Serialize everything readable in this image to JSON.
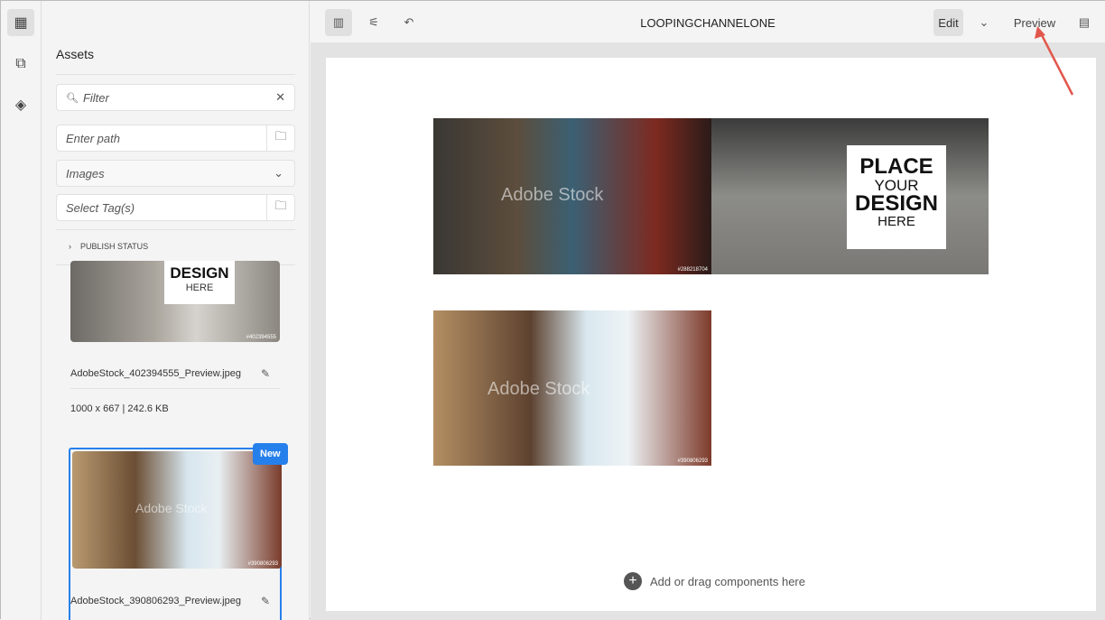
{
  "rail": {
    "items": [
      "assets-icon",
      "components-icon",
      "layers-icon"
    ]
  },
  "panel": {
    "title": "Assets",
    "filter_placeholder": "Filter",
    "path_placeholder": "Enter path",
    "type_select": "Images",
    "tags_placeholder": "Select Tag(s)",
    "publish_status": "PUBLISH STATUS",
    "assets": [
      {
        "name": "AdobeStock_402394555_Preview.jpeg",
        "meta": "1000 x 667 | 242.6 KB",
        "thumb_text": "DESIGN",
        "thumb_text2": "HERE",
        "stock_id": "#402394555"
      },
      {
        "name": "AdobeStock_390806293_Preview.jpeg",
        "badge": "New",
        "watermark": "Adobe Stock",
        "stock_id": "#390806293"
      }
    ]
  },
  "toolbar": {
    "title": "LOOPINGCHANNELONE",
    "edit": "Edit",
    "preview": "Preview"
  },
  "canvas": {
    "watermark": "Adobe Stock",
    "place1": "PLACE",
    "place2": "YOUR",
    "place3": "DESIGN",
    "place4": "HERE",
    "id1": "#288218704",
    "id3": "#390806293",
    "add_components": "Add or drag components here"
  },
  "colors": {
    "accent": "#2680eb",
    "arrow": "#e2574c"
  }
}
